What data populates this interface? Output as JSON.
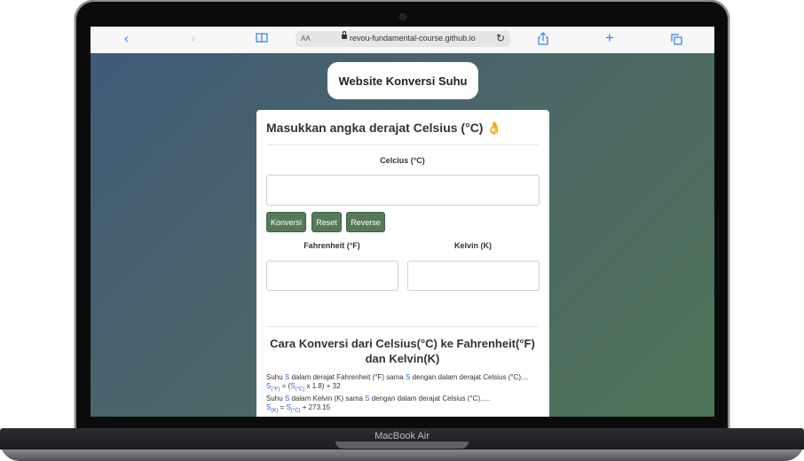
{
  "device": {
    "label": "MacBook Air"
  },
  "browser": {
    "url_prefix": "AA",
    "url": "revou-fundamental-course.github.io",
    "icons": [
      "back-icon",
      "forward-icon",
      "bookmarks-icon",
      "lock-icon",
      "reload-icon",
      "share-icon",
      "new-tab-icon",
      "tabs-icon"
    ]
  },
  "page": {
    "title": "Website Konversi Suhu",
    "heading": "Masukkan angka derajat Celsius (°C)",
    "heading_emoji": "👌",
    "celsius_label": "Celcius (°C)",
    "buttons": {
      "convert": "Konversi",
      "reset": "Reset",
      "reverse": "Reverse"
    },
    "fahrenheit_label": "Fahrenheit (°F)",
    "kelvin_label": "Kelvin (K)",
    "section_title": "Cara Konversi dari Celsius(°C) ke Fahrenheit(°F) dan Kelvin(K)",
    "explanation": {
      "line1_a": "Suhu ",
      "var_s": "S",
      "line1_b": " dalam derajat Fahrenheit (°F) sama ",
      "line1_c": " dengan dalam derajat Celsius (°C)....",
      "formula1_sub_f": "(°F)",
      "formula1_mid": " = (",
      "formula1_sub_c": "(°C)",
      "formula1_end": " x 1.8) + 32",
      "line2_a": "Suhu ",
      "line2_b": " dalam Kelvin (K) sama ",
      "line2_c": " dengan dalam derajat Celsius (°C).....",
      "formula2_sub_k": "(K)",
      "formula2_mid": " = ",
      "formula2_sub_c": "(°C)",
      "formula2_end": " + 273.15"
    }
  },
  "colors": {
    "button_green": "#557a5a",
    "link_blue": "#2f7ff5",
    "gradient_start": "#3e5b78",
    "gradient_end": "#4e7456"
  }
}
